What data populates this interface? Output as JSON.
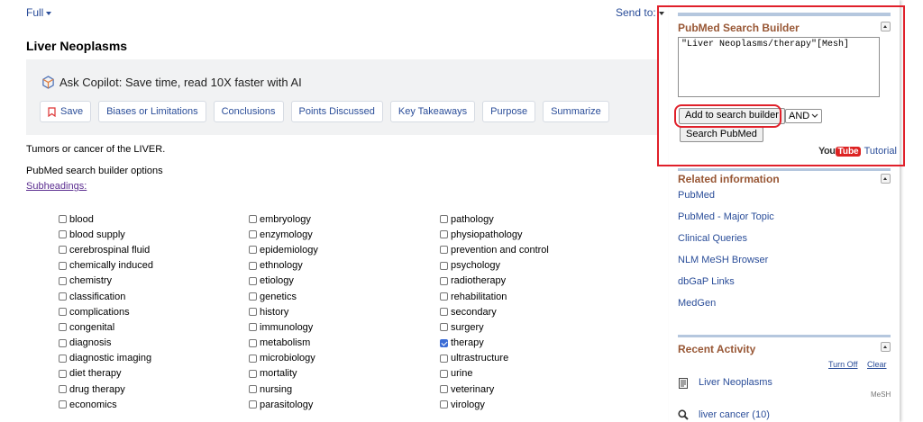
{
  "top": {
    "format_label": "Full",
    "send_to_label": "Send to:"
  },
  "page_title": "Liver Neoplasms",
  "copilot": {
    "heading": "Ask Copilot: Save time, read 10X faster with AI",
    "pills": [
      "Save",
      "Biases or Limitations",
      "Conclusions",
      "Points Discussed",
      "Key Takeaways",
      "Purpose",
      "Summarize"
    ]
  },
  "description": "Tumors or cancer of the LIVER.",
  "builder_options_label": "PubMed search builder options",
  "subheadings_label": "Subheadings:",
  "subheadings": {
    "col1": [
      {
        "label": "blood",
        "checked": false
      },
      {
        "label": "blood supply",
        "checked": false
      },
      {
        "label": "cerebrospinal fluid",
        "checked": false
      },
      {
        "label": "chemically induced",
        "checked": false
      },
      {
        "label": "chemistry",
        "checked": false
      },
      {
        "label": "classification",
        "checked": false
      },
      {
        "label": "complications",
        "checked": false
      },
      {
        "label": "congenital",
        "checked": false
      },
      {
        "label": "diagnosis",
        "checked": false
      },
      {
        "label": "diagnostic imaging",
        "checked": false
      },
      {
        "label": "diet therapy",
        "checked": false
      },
      {
        "label": "drug therapy",
        "checked": false
      },
      {
        "label": "economics",
        "checked": false
      }
    ],
    "col2": [
      {
        "label": "embryology",
        "checked": false
      },
      {
        "label": "enzymology",
        "checked": false
      },
      {
        "label": "epidemiology",
        "checked": false
      },
      {
        "label": "ethnology",
        "checked": false
      },
      {
        "label": "etiology",
        "checked": false
      },
      {
        "label": "genetics",
        "checked": false
      },
      {
        "label": "history",
        "checked": false
      },
      {
        "label": "immunology",
        "checked": false
      },
      {
        "label": "metabolism",
        "checked": false
      },
      {
        "label": "microbiology",
        "checked": false
      },
      {
        "label": "mortality",
        "checked": false
      },
      {
        "label": "nursing",
        "checked": false
      },
      {
        "label": "parasitology",
        "checked": false
      }
    ],
    "col3": [
      {
        "label": "pathology",
        "checked": false
      },
      {
        "label": "physiopathology",
        "checked": false
      },
      {
        "label": "prevention and control",
        "checked": false
      },
      {
        "label": "psychology",
        "checked": false
      },
      {
        "label": "radiotherapy",
        "checked": false
      },
      {
        "label": "rehabilitation",
        "checked": false
      },
      {
        "label": "secondary",
        "checked": false
      },
      {
        "label": "surgery",
        "checked": false
      },
      {
        "label": "therapy",
        "checked": true
      },
      {
        "label": "ultrastructure",
        "checked": false
      },
      {
        "label": "urine",
        "checked": false
      },
      {
        "label": "veterinary",
        "checked": false
      },
      {
        "label": "virology",
        "checked": false
      }
    ]
  },
  "search_builder": {
    "title": "PubMed Search Builder",
    "query": "\"Liver Neoplasms/therapy\"[Mesh]",
    "add_button": "Add to search builder",
    "operator": "AND",
    "search_button": "Search PubMed",
    "youtube_logo": {
      "you": "You",
      "tube": "Tube"
    },
    "tutorial_label": "Tutorial"
  },
  "related": {
    "title": "Related information",
    "links": [
      "PubMed",
      "PubMed - Major Topic",
      "Clinical Queries",
      "NLM MeSH Browser",
      "dbGaP Links",
      "MedGen"
    ]
  },
  "recent": {
    "title": "Recent Activity",
    "turn_off": "Turn Off",
    "clear": "Clear",
    "items": [
      {
        "label": "Liver Neoplasms",
        "db": "MeSH",
        "icon": "document-icon"
      },
      {
        "label": "liver cancer (10)",
        "db": "",
        "icon": "search-icon"
      }
    ]
  },
  "colors": {
    "link": "#2a4d99",
    "box_title": "#985735",
    "highlight": "#e0202a",
    "copilot_bg": "#f1f2f3",
    "save_icon": "#d33"
  }
}
